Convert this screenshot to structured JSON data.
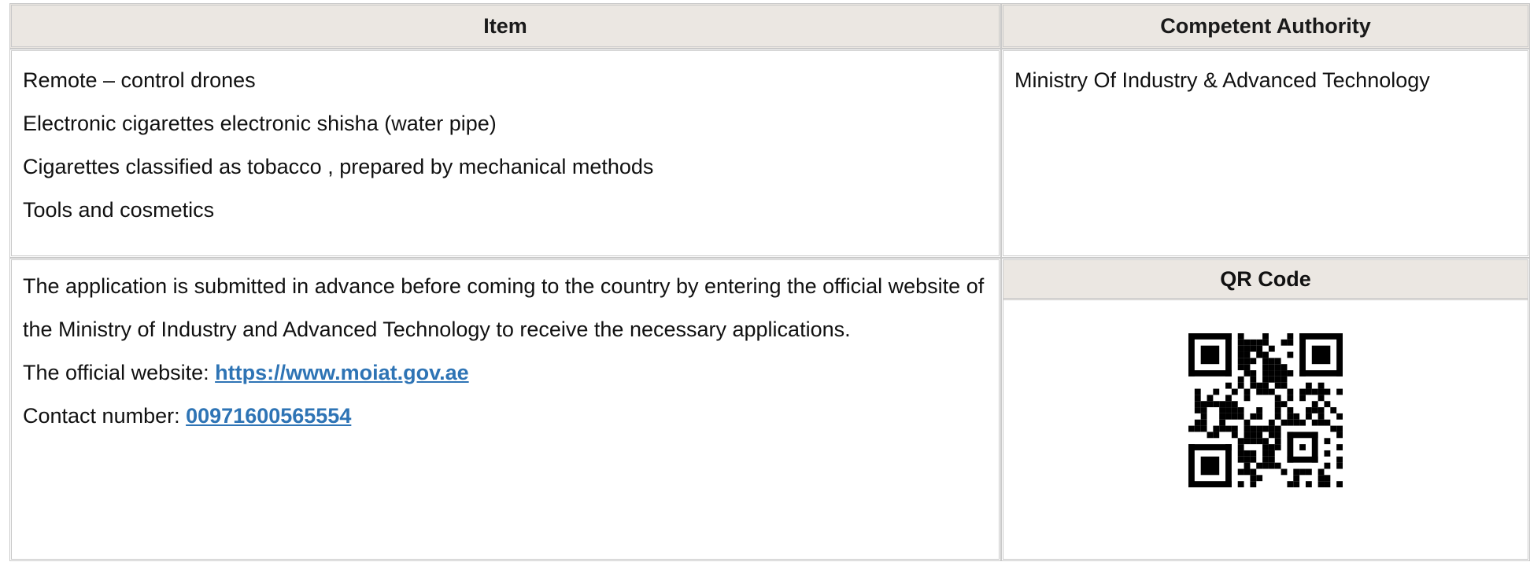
{
  "table": {
    "header_item": "Item",
    "header_authority": "Competent Authority",
    "items": [
      "Remote – control drones",
      "Electronic cigarettes electronic shisha (water pipe)",
      "Cigarettes classified as tobacco , prepared by mechanical methods",
      "Tools and cosmetics"
    ],
    "authority": "Ministry Of Industry & Advanced Technology",
    "instructions": {
      "text": "The application is submitted in advance before coming to the country by entering the official website of the Ministry of Industry and Advanced Technology to receive the necessary applications.",
      "website_label": "The official website: ",
      "website_url": "https://www.moiat.gov.ae",
      "contact_label": "Contact number: ",
      "contact_number": "00971600565554"
    },
    "qr_header": "QR Code"
  },
  "colors": {
    "header_bg": "#ebe7e2",
    "border": "#c9c9c9",
    "link": "#2e74b5"
  },
  "icons": {
    "qr": "qr-code-icon"
  }
}
